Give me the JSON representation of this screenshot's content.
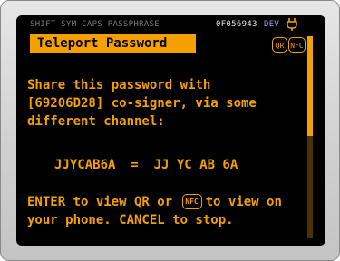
{
  "status_bar": {
    "flags": "SHIFT SYM CAPS  PASSPHRASE",
    "fingerprint": "0F056943",
    "mode": "DEV",
    "power_icon": "usb-plug-icon"
  },
  "title": "Teleport Password",
  "badges": {
    "qr": "QR",
    "nfc": "NFC"
  },
  "message": {
    "line1": "Share this password with",
    "line2": "[69206D28] co-signer, via some",
    "line3": "different channel:",
    "password_line": "JJYCAB6A  =  JJ YC AB 6A",
    "line5_a": "ENTER to view QR or",
    "line5_nfc": "NFC",
    "line5_b": "to view on",
    "line6": "your phone. CANCEL to stop."
  },
  "colors": {
    "accent": "#f4a000",
    "background": "#000000",
    "dev_label": "#8fa6ff"
  }
}
